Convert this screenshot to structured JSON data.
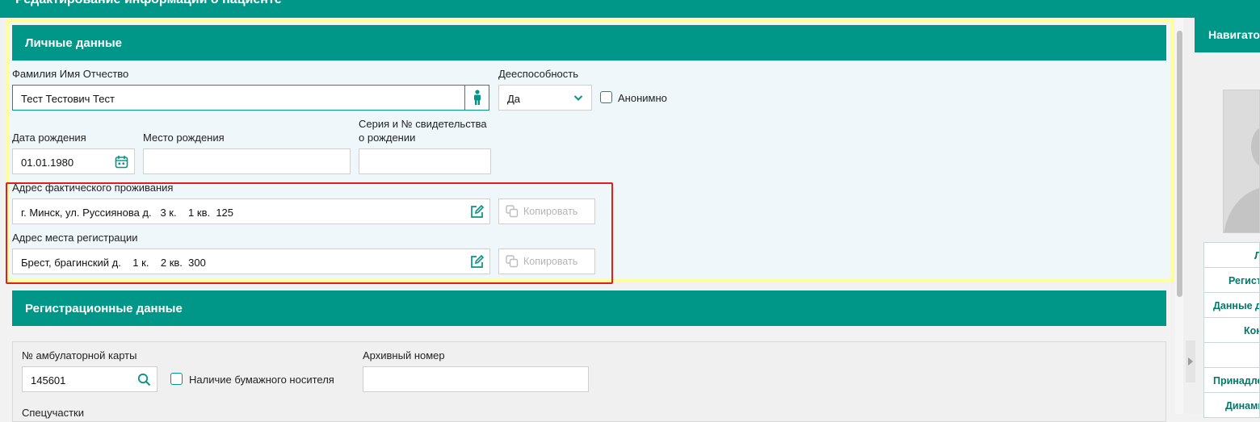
{
  "window": {
    "title": "Редактирование информации о пациенте"
  },
  "personal": {
    "header": "Личные данные",
    "fio_label": "Фамилия Имя Отчество",
    "fio_value": "Тест Тестович Тест",
    "capacity_label": "Дееспособность",
    "capacity_value": "Да",
    "anon_label": "Анонимно",
    "birthdate_label": "Дата рождения",
    "birthdate_value": "01.01.1980",
    "birthplace_label": "Место рождения",
    "birthplace_value": "",
    "cert_label_1": "Серия и № свидетельства",
    "cert_label_2": "о рождении",
    "cert_value": "",
    "actual_address_label": "Адрес фактического проживания",
    "actual_address_value": "г. Минск, ул. Руссиянова д.   3 к.    1 кв.  125",
    "reg_address_label": "Адрес места регистрации",
    "reg_address_value": "Брест, брагинский д.    1 к.    2 кв.  300",
    "copy_label": "Копировать"
  },
  "registration": {
    "header": "Регистрационные данные",
    "card_label": "№ амбулаторной карты",
    "card_value": "145601",
    "paper_label": "Наличие бумажного носителя",
    "archive_label": "Архивный номер",
    "archive_value": "",
    "partial_label": "Спецучастки"
  },
  "navigator": {
    "header": "Навигатор",
    "items": [
      "Л",
      "Регист",
      "Данные д",
      "Кон",
      "",
      "Принадле",
      "Динами"
    ]
  },
  "colors": {
    "accent": "#009688",
    "highlight": "#ffff99",
    "alert": "#e01e1e"
  },
  "icons": [
    "person-icon",
    "chevron-down-icon",
    "calendar-icon",
    "edit-icon",
    "copy-icon",
    "search-icon"
  ]
}
